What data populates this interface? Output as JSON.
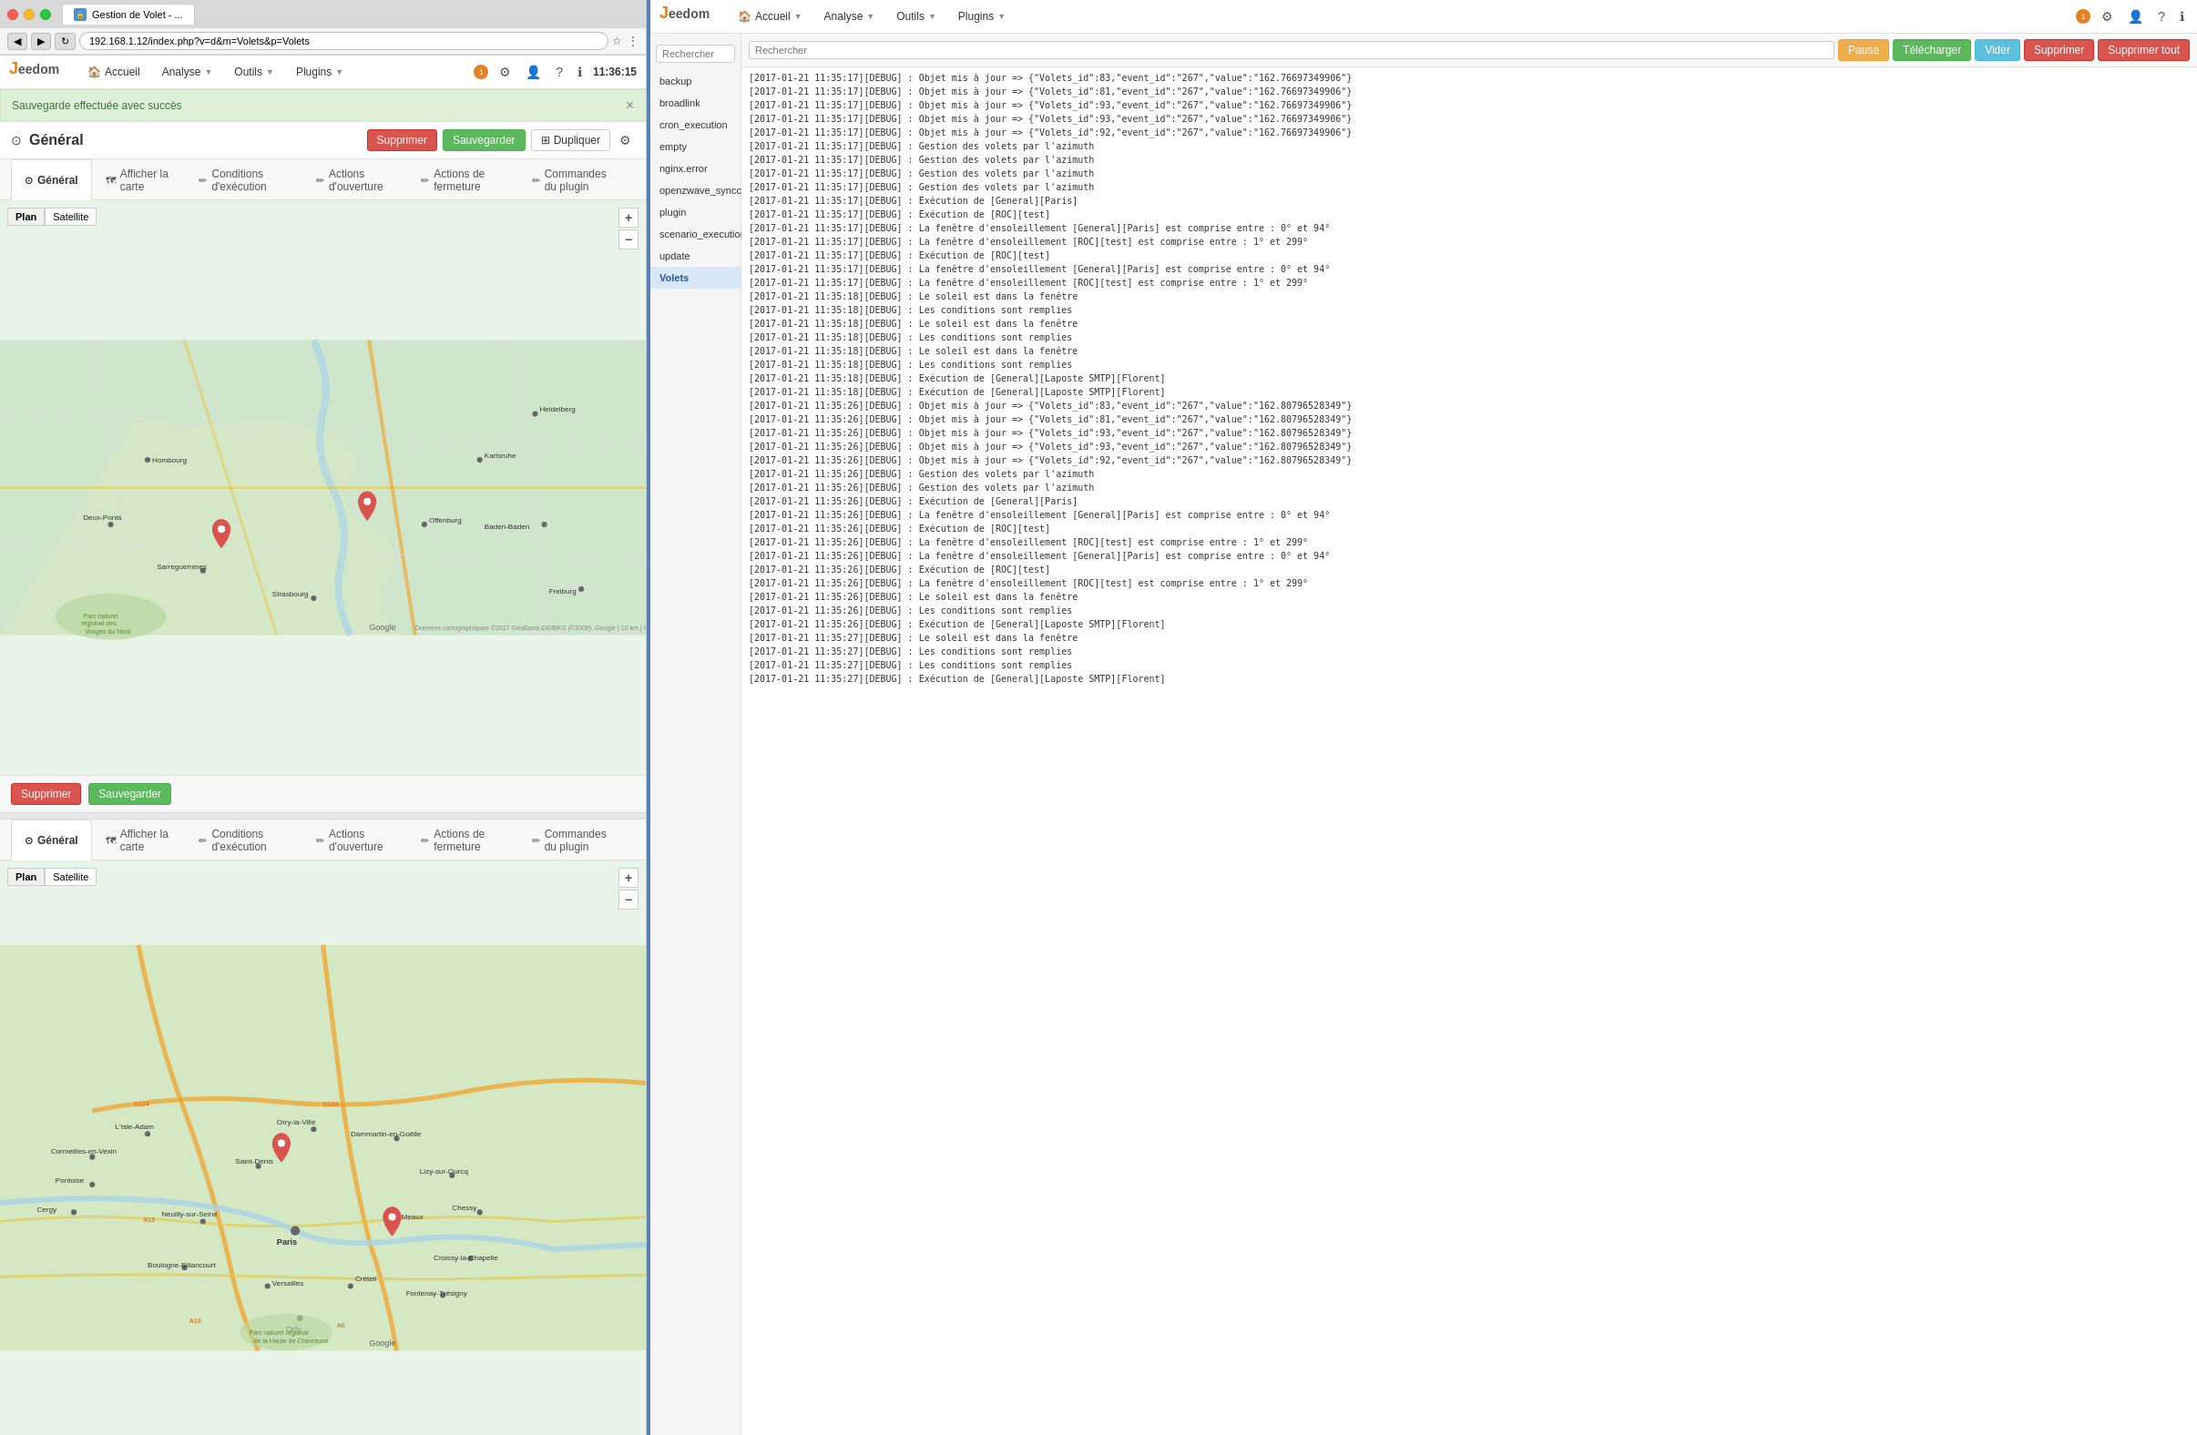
{
  "browser": {
    "tab_title": "Gestion de Volet - ...",
    "address": "192.168.1.12/index.php?v=d&m=Volets&p=Volets"
  },
  "app": {
    "logo": "JEEDOM",
    "logo_j": "J",
    "logo_rest": "eedom",
    "nav_items": [
      {
        "label": "Accueil",
        "has_dropdown": false
      },
      {
        "label": "Analyse",
        "has_dropdown": true
      },
      {
        "label": "Outils",
        "has_dropdown": true
      },
      {
        "label": "Plugins",
        "has_dropdown": true
      }
    ],
    "notification_count": "1",
    "time": "11:36:15"
  },
  "alert": {
    "message": "Sauvegarde effectuée avec succès"
  },
  "page": {
    "title": "Général",
    "title_icon": "⊙",
    "tabs": [
      {
        "label": "Général",
        "icon": "⊙",
        "active": true
      },
      {
        "label": "Afficher la carte",
        "icon": "🗺",
        "active": false
      },
      {
        "label": "Conditions d'exécution",
        "icon": "✏",
        "active": false
      },
      {
        "label": "Actions d'ouverture",
        "icon": "✏",
        "active": false
      },
      {
        "label": "Actions de fermeture",
        "icon": "✏",
        "active": false
      },
      {
        "label": "Commandes du plugin",
        "icon": "✏",
        "active": false
      }
    ],
    "buttons": {
      "delete": "Supprimer",
      "save": "Sauvegarder",
      "duplicate": "Dupliquer"
    }
  },
  "map_type": {
    "options": [
      "Plan",
      "Satellite"
    ],
    "active": "Plan"
  },
  "second_section": {
    "tabs": [
      {
        "label": "Général",
        "icon": "⊙",
        "active": true
      },
      {
        "label": "Afficher la carte",
        "icon": "🗺",
        "active": false
      },
      {
        "label": "Conditions d'exécution",
        "icon": "✏",
        "active": false
      },
      {
        "label": "Actions d'ouverture",
        "icon": "✏",
        "active": false
      },
      {
        "label": "Actions de fermeture",
        "icon": "✏",
        "active": false
      },
      {
        "label": "Commandes du plugin",
        "icon": "✏",
        "active": false
      }
    ]
  },
  "save_buttons": {
    "delete": "Supprimer",
    "save": "Sauvegarder"
  },
  "right_panel": {
    "logo": "JEEDOM",
    "nav_items": [
      {
        "label": "Accueil",
        "has_dropdown": true
      },
      {
        "label": "Analyse",
        "has_dropdown": true
      },
      {
        "label": "Outils",
        "has_dropdown": true
      },
      {
        "label": "Plugins",
        "has_dropdown": true
      }
    ],
    "notification_count": "1"
  },
  "sidebar": {
    "search_placeholder": "Rechercher",
    "items": [
      {
        "label": "backup",
        "active": false
      },
      {
        "label": "broadlink",
        "active": false
      },
      {
        "label": "cron_execution",
        "active": false
      },
      {
        "label": "empty",
        "active": false
      },
      {
        "label": "nginx.error",
        "active": false
      },
      {
        "label": "openzwave_syncconf",
        "active": false
      },
      {
        "label": "plugin",
        "active": false
      },
      {
        "label": "scenario_execution",
        "active": false
      },
      {
        "label": "update",
        "active": false
      },
      {
        "label": "Volets",
        "active": true
      }
    ]
  },
  "log_controls": {
    "search_placeholder": "Rechercher",
    "pause": "Pause",
    "download": "Télécharger",
    "clear": "Vider",
    "delete": "Supprimer",
    "delete_all": "Supprimer tout"
  },
  "log_entries": [
    "[2017-01-21 11:35:17][DEBUG] : Objet mis à jour => {\"Volets_id\":83,\"event_id\":\"267\",\"value\":\"162.76697349906\"}",
    "[2017-01-21 11:35:17][DEBUG] : Objet mis à jour => {\"Volets_id\":81,\"event_id\":\"267\",\"value\":\"162.76697349906\"}",
    "[2017-01-21 11:35:17][DEBUG] : Objet mis à jour => {\"Volets_id\":93,\"event_id\":\"267\",\"value\":\"162.76697349906\"}",
    "[2017-01-21 11:35:17][DEBUG] : Objet mis à jour => {\"Volets_id\":93,\"event_id\":\"267\",\"value\":\"162.76697349906\"}",
    "[2017-01-21 11:35:17][DEBUG] : Objet mis à jour => {\"Volets_id\":92,\"event_id\":\"267\",\"value\":\"162.76697349906\"}",
    "[2017-01-21 11:35:17][DEBUG] : Gestion des volets par l'azimuth",
    "[2017-01-21 11:35:17][DEBUG] : Gestion des volets par l'azimuth",
    "[2017-01-21 11:35:17][DEBUG] : Gestion des volets par l'azimuth",
    "[2017-01-21 11:35:17][DEBUG] : Gestion des volets par l'azimuth",
    "[2017-01-21 11:35:17][DEBUG] : Exécution de [General][Paris]",
    "[2017-01-21 11:35:17][DEBUG] : Exécution de [ROC][test]",
    "[2017-01-21 11:35:17][DEBUG] : La fenêtre d'ensoleillement [General][Paris] est comprise entre : 0° et 94°",
    "[2017-01-21 11:35:17][DEBUG] : La fenêtre d'ensoleillement [ROC][test] est comprise entre : 1° et 299°",
    "[2017-01-21 11:35:17][DEBUG] : Exécution de [ROC][test]",
    "[2017-01-21 11:35:17][DEBUG] : La fenêtre d'ensoleillement [General][Paris] est comprise entre : 0° et 94°",
    "[2017-01-21 11:35:17][DEBUG] : La fenêtre d'ensoleillement [ROC][test] est comprise entre : 1° et 299°",
    "[2017-01-21 11:35:18][DEBUG] : Le soleil est dans la fenêtre",
    "[2017-01-21 11:35:18][DEBUG] : Les conditions sont remplies",
    "[2017-01-21 11:35:18][DEBUG] : Le soleil est dans la fenêtre",
    "[2017-01-21 11:35:18][DEBUG] : Les conditions sont remplies",
    "[2017-01-21 11:35:18][DEBUG] : Le soleil est dans la fenêtre",
    "[2017-01-21 11:35:18][DEBUG] : Les conditions sont remplies",
    "[2017-01-21 11:35:18][DEBUG] : Exécution de [General][Laposte SMTP][Florent]",
    "[2017-01-21 11:35:18][DEBUG] : Exécution de [General][Laposte SMTP][Florent]",
    "[2017-01-21 11:35:26][DEBUG] : Objet mis à jour => {\"Volets_id\":83,\"event_id\":\"267\",\"value\":\"162.80796528349\"}",
    "[2017-01-21 11:35:26][DEBUG] : Objet mis à jour => {\"Volets_id\":81,\"event_id\":\"267\",\"value\":\"162.80796528349\"}",
    "[2017-01-21 11:35:26][DEBUG] : Objet mis à jour => {\"Volets_id\":93,\"event_id\":\"267\",\"value\":\"162.80796528349\"}",
    "[2017-01-21 11:35:26][DEBUG] : Objet mis à jour => {\"Volets_id\":93,\"event_id\":\"267\",\"value\":\"162.80796528349\"}",
    "[2017-01-21 11:35:26][DEBUG] : Objet mis à jour => {\"Volets_id\":92,\"event_id\":\"267\",\"value\":\"162.80796528349\"}",
    "[2017-01-21 11:35:26][DEBUG] : Gestion des volets par l'azimuth",
    "[2017-01-21 11:35:26][DEBUG] : Gestion des volets par l'azimuth",
    "[2017-01-21 11:35:26][DEBUG] : Exécution de [General][Paris]",
    "[2017-01-21 11:35:26][DEBUG] : La fenêtre d'ensoleillement [General][Paris] est comprise entre : 0° et 94°",
    "[2017-01-21 11:35:26][DEBUG] : Exécution de [ROC][test]",
    "[2017-01-21 11:35:26][DEBUG] : La fenêtre d'ensoleillement [ROC][test] est comprise entre : 1° et 299°",
    "[2017-01-21 11:35:26][DEBUG] : La fenêtre d'ensoleillement [General][Paris] est comprise entre : 0° et 94°",
    "[2017-01-21 11:35:26][DEBUG] : Exécution de [ROC][test]",
    "[2017-01-21 11:35:26][DEBUG] : La fenêtre d'ensoleillement [ROC][test] est comprise entre : 1° et 299°",
    "[2017-01-21 11:35:26][DEBUG] : Le soleil est dans la fenêtre",
    "[2017-01-21 11:35:26][DEBUG] : Les conditions sont remplies",
    "[2017-01-21 11:35:26][DEBUG] : Exécution de [General][Laposte SMTP][Florent]",
    "[2017-01-21 11:35:27][DEBUG] : Le soleil est dans la fenêtre",
    "[2017-01-21 11:35:27][DEBUG] : Les conditions sont remplies",
    "[2017-01-21 11:35:27][DEBUG] : Les conditions sont remplies",
    "[2017-01-21 11:35:27][DEBUG] : Exécution de [General][Laposte SMTP][Florent]"
  ]
}
